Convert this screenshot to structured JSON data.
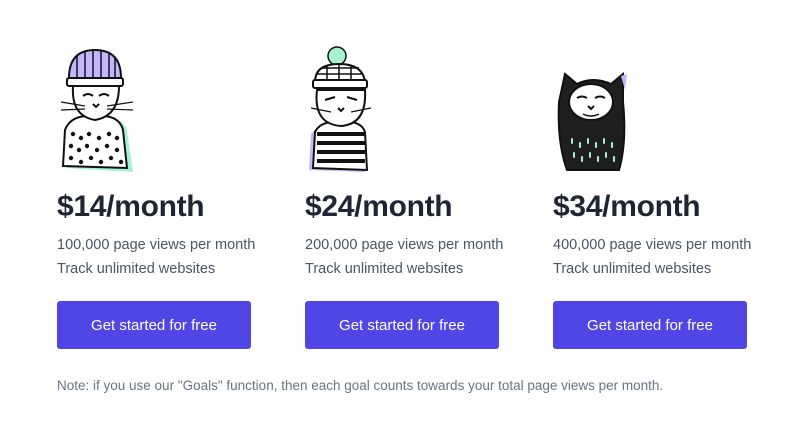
{
  "plans": [
    {
      "illustration": "cat-in-beanie-illustration",
      "price": "$14/month",
      "features": [
        "100,000 page views per month",
        "Track unlimited websites"
      ],
      "cta_label": "Get started for free"
    },
    {
      "illustration": "cat-in-pompom-hat-illustration",
      "price": "$24/month",
      "features": [
        "200,000 page views per month",
        "Track unlimited websites"
      ],
      "cta_label": "Get started for free"
    },
    {
      "illustration": "cat-in-hood-illustration",
      "price": "$34/month",
      "features": [
        "400,000 page views per month",
        "Track unlimited websites"
      ],
      "cta_label": "Get started for free"
    }
  ],
  "note": "Note: if you use our \"Goals\" function, then each goal counts towards your total page views per month.",
  "colors": {
    "accent": "#4f46e5",
    "mint": "#a7f3d0",
    "lavender": "#c4b5fd"
  }
}
